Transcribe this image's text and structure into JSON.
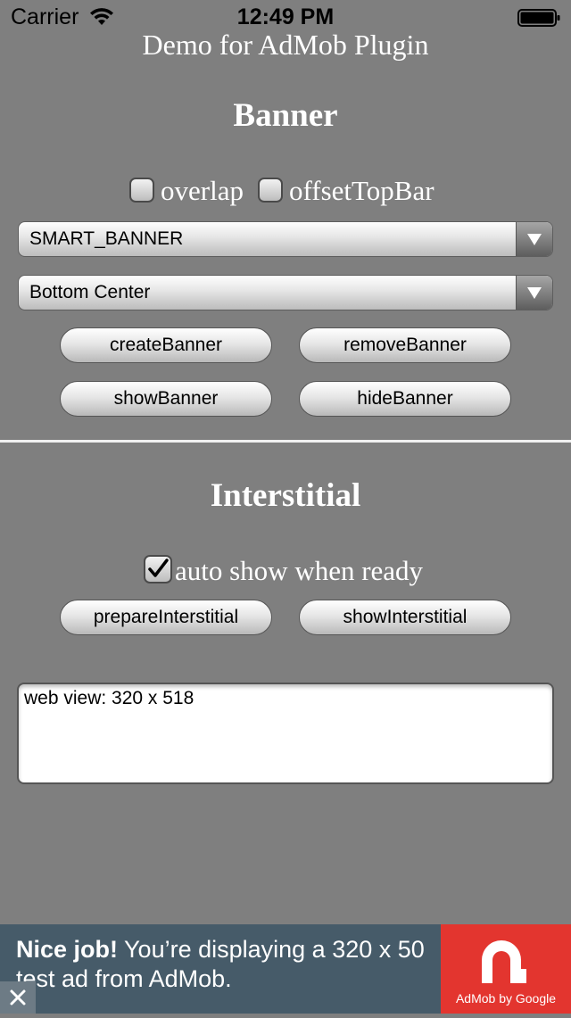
{
  "status_bar": {
    "carrier": "Carrier",
    "time": "12:49 PM",
    "wifi_icon": "wifi-icon",
    "battery_icon": "battery-icon"
  },
  "page": {
    "title": "Demo for AdMob Plugin"
  },
  "banner_section": {
    "heading": "Banner",
    "overlap_label": "overlap",
    "overlap_checked": false,
    "offset_label": "offsetTopBar",
    "offset_checked": false,
    "size_select_value": "SMART_BANNER",
    "position_select_value": "Bottom Center",
    "buttons": {
      "create": "createBanner",
      "remove": "removeBanner",
      "show": "showBanner",
      "hide": "hideBanner"
    }
  },
  "interstitial_section": {
    "heading": "Interstitial",
    "autoshow_label": "auto show when ready",
    "autoshow_checked": true,
    "buttons": {
      "prepare": "prepareInterstitial",
      "show": "showInterstitial"
    }
  },
  "webview": {
    "text": "web view: 320 x 518"
  },
  "ad": {
    "headline": "Nice job!",
    "body": "You’re displaying a 320 x 50 test ad from AdMob.",
    "logo_text": "AdMob by Google",
    "background_color": "#465b69",
    "logo_color": "#e3352f"
  }
}
